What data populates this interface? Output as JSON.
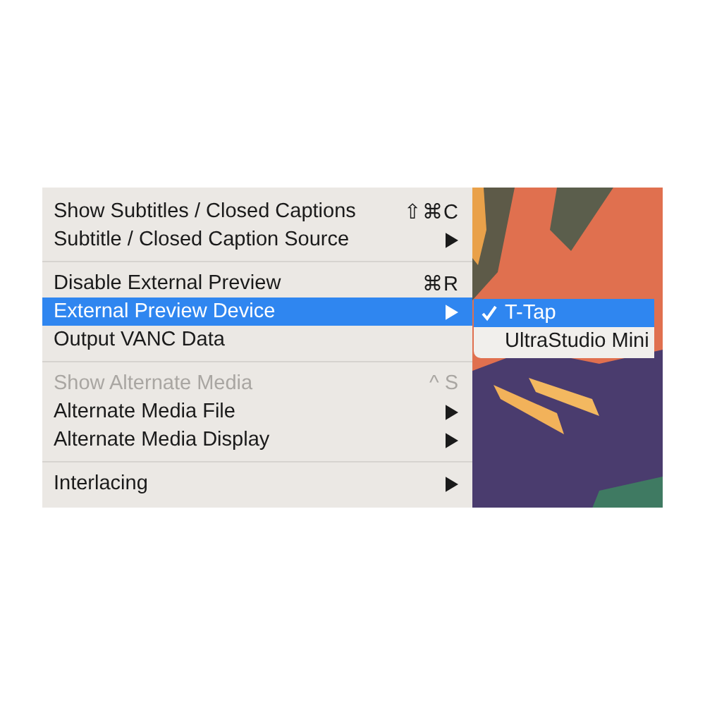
{
  "menu": {
    "sections": [
      {
        "items": [
          {
            "label": "Show Subtitles / Closed Captions",
            "shortcut": "⇧⌘C",
            "submenu": false,
            "disabled": false,
            "selected": false
          },
          {
            "label": "Subtitle / Closed Caption Source",
            "submenu": true,
            "disabled": false,
            "selected": false
          }
        ]
      },
      {
        "items": [
          {
            "label": "Disable External Preview",
            "shortcut": "⌘R",
            "submenu": false,
            "disabled": false,
            "selected": false
          },
          {
            "label": "External Preview Device",
            "submenu": true,
            "disabled": false,
            "selected": true
          },
          {
            "label": "Output VANC Data",
            "submenu": false,
            "disabled": false,
            "selected": false
          }
        ]
      },
      {
        "items": [
          {
            "label": "Show Alternate Media",
            "shortcut": "^ S",
            "submenu": false,
            "disabled": true,
            "selected": false
          },
          {
            "label": "Alternate Media File",
            "submenu": true,
            "disabled": false,
            "selected": false
          },
          {
            "label": "Alternate Media Display",
            "submenu": true,
            "disabled": false,
            "selected": false
          }
        ]
      },
      {
        "items": [
          {
            "label": "Interlacing",
            "submenu": true,
            "disabled": false,
            "selected": false
          }
        ]
      }
    ]
  },
  "submenu": {
    "items": [
      {
        "label": "T-Tap",
        "checked": true,
        "selected": true
      },
      {
        "label": "UltraStudio Mini",
        "checked": false,
        "selected": false
      }
    ]
  }
}
